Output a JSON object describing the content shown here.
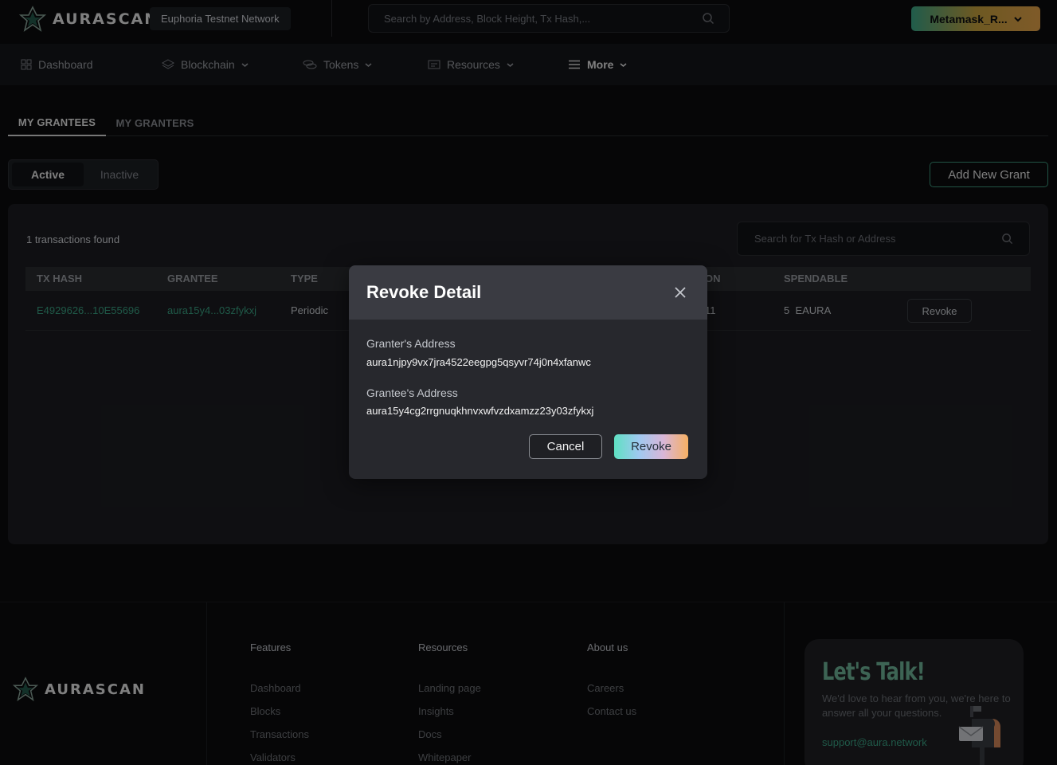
{
  "app": {
    "logo_text": "AURASCAN",
    "network": "Euphoria Testnet Network"
  },
  "header": {
    "search_placeholder": "Search by Address, Block Height, Tx Hash,...",
    "wallet_label": "Metamask_R..."
  },
  "nav": {
    "items": [
      {
        "label": "Dashboard",
        "icon": "grid-icon"
      },
      {
        "label": "Blockchain",
        "icon": "layers-icon"
      },
      {
        "label": "Tokens",
        "icon": "coins-icon"
      },
      {
        "label": "Resources",
        "icon": "resources-icon"
      },
      {
        "label": "More",
        "icon": "menu-icon"
      }
    ]
  },
  "tabs": {
    "grantees": "MY GRANTEES",
    "granters": "MY GRANTERS"
  },
  "filter": {
    "active": "Active",
    "inactive": "Inactive"
  },
  "add_grant_label": "Add New Grant",
  "table": {
    "count_text": "1 transactions found",
    "search_placeholder": "Search for Tx Hash or Address",
    "headers": {
      "tx_hash": "TX HASH",
      "grantee": "GRANTEE",
      "type": "TYPE",
      "expiration_partial": "ON",
      "spendable": "SPENDABLE"
    },
    "rows": [
      {
        "tx_hash": "E4929626...10E55696",
        "grantee": "aura15y4...03zfykxj",
        "type": "Periodic",
        "expiration_partial": "11",
        "spendable": "5  EAURA",
        "action": "Revoke"
      }
    ]
  },
  "modal": {
    "title": "Revoke Detail",
    "granter_label": "Granter's Address",
    "granter_value": "aura1njpy9vx7jra4522eegpg5qsyvr74j0n4xfanwc",
    "grantee_label": "Grantee's Address",
    "grantee_value": "aura15y4cg2rrgnuqkhnvxwfvzdxamzz23y03zfykxj",
    "cancel_label": "Cancel",
    "revoke_label": "Revoke"
  },
  "footer": {
    "logo_text": "AURASCAN",
    "features": {
      "title": "Features",
      "links": [
        "Dashboard",
        "Blocks",
        "Transactions",
        "Validators"
      ]
    },
    "resources": {
      "title": "Resources",
      "links": [
        "Landing page",
        "Insights",
        "Docs",
        "Whitepaper"
      ]
    },
    "about": {
      "title": "About us",
      "links": [
        "Careers",
        "Contact us"
      ]
    },
    "talk": {
      "title": "Let's Talk!",
      "text": "We'd love to hear from you, we're here to answer all your questions.",
      "email": "support@aura.network"
    }
  },
  "colors": {
    "accent": "#3aa283",
    "background": "#0b0c0e",
    "panel": "#1c1d21",
    "modal": "#27282d"
  }
}
